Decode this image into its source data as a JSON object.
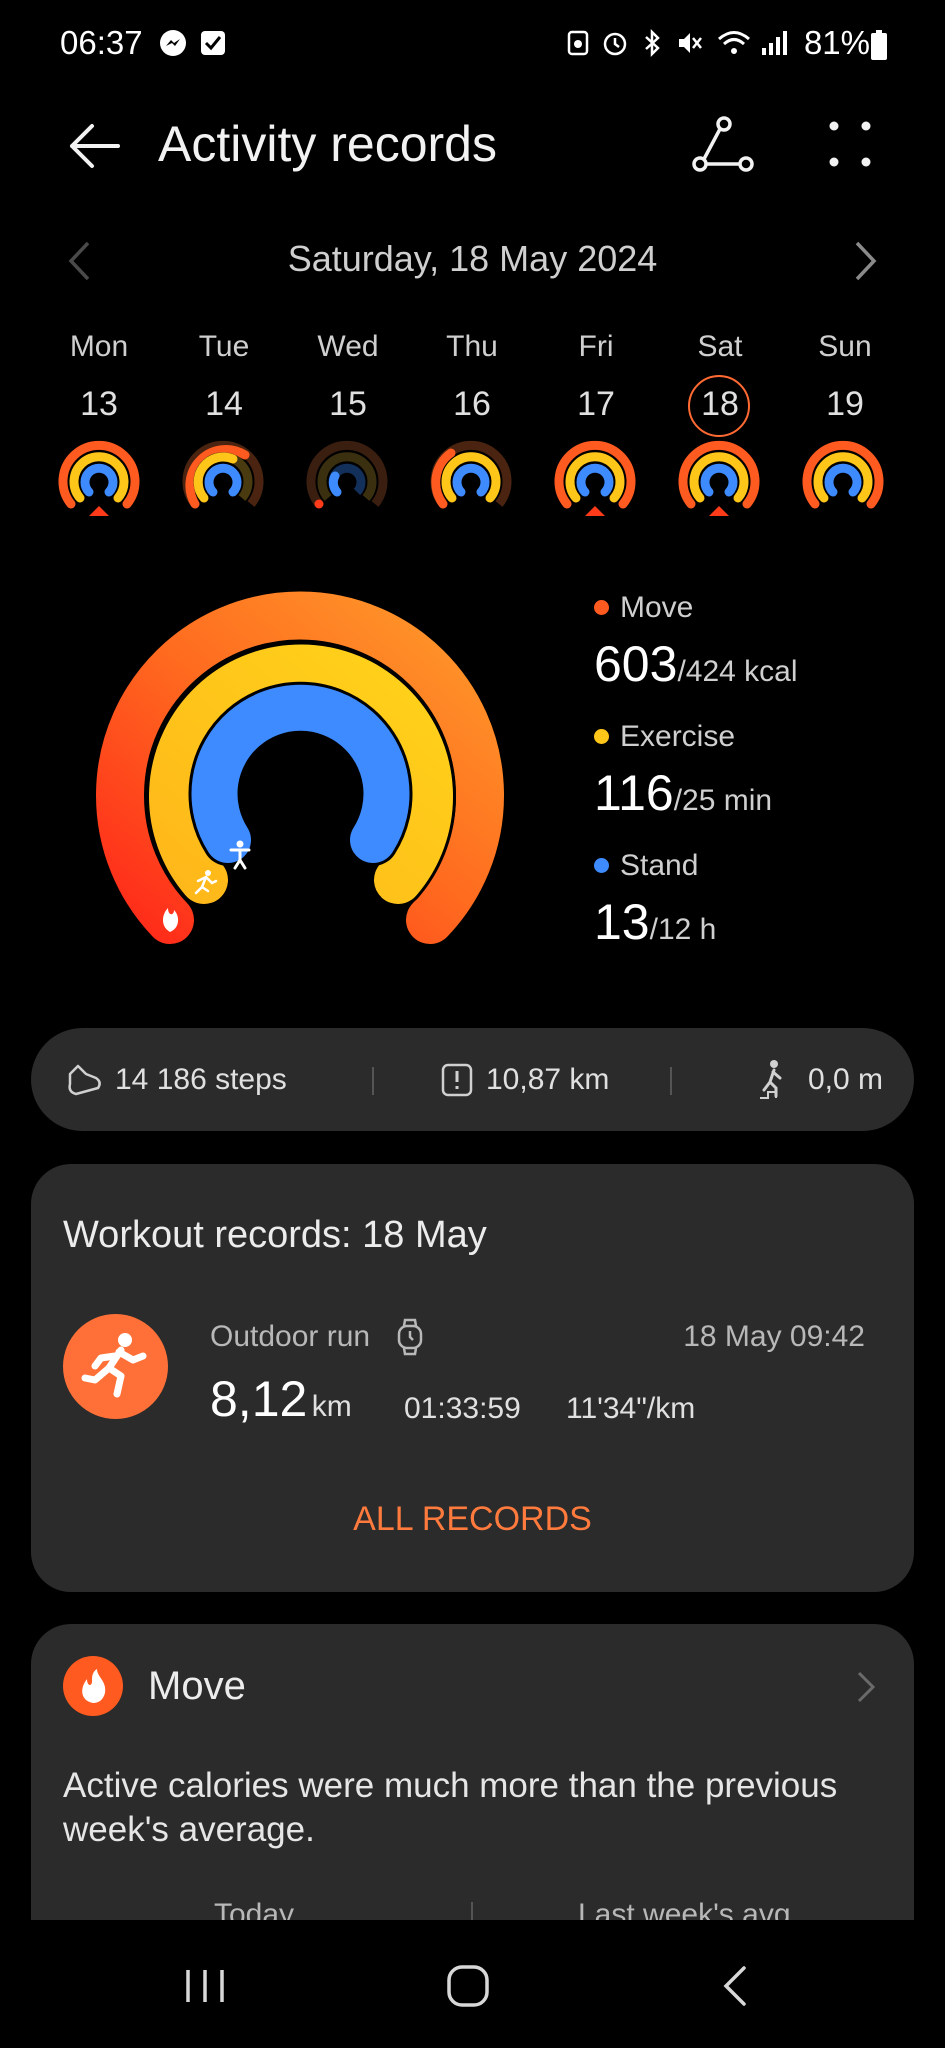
{
  "status": {
    "time": "06:37",
    "battery": "81%"
  },
  "header": {
    "title": "Activity records"
  },
  "date_nav": {
    "label": "Saturday, 18 May 2024"
  },
  "week": [
    {
      "name": "Mon",
      "num": "13"
    },
    {
      "name": "Tue",
      "num": "14"
    },
    {
      "name": "Wed",
      "num": "15"
    },
    {
      "name": "Thu",
      "num": "16"
    },
    {
      "name": "Fri",
      "num": "17"
    },
    {
      "name": "Sat",
      "num": "18"
    },
    {
      "name": "Sun",
      "num": "19"
    }
  ],
  "rings": {
    "move": {
      "label": "Move",
      "value": "603",
      "goal": "/424 kcal",
      "color": "#ff5a1f"
    },
    "exercise": {
      "label": "Exercise",
      "value": "116",
      "goal": "/25 min",
      "color": "#ffc61a"
    },
    "stand": {
      "label": "Stand",
      "value": "13",
      "goal": "/12 h",
      "color": "#3d8bff"
    }
  },
  "summary": {
    "steps": "14 186 steps",
    "distance": "10,87 km",
    "elevation": "0,0 m"
  },
  "workouts": {
    "title": "Workout records: 18 May",
    "type": "Outdoor run",
    "datetime": "18 May 09:42",
    "distance_value": "8,12",
    "distance_unit": "km",
    "duration": "01:33:59",
    "pace": "11'34\"/km",
    "all_records": "ALL RECORDS"
  },
  "move_card": {
    "title": "Move",
    "text": "Active calories were much more than the previous week's average.",
    "col1": "Today",
    "col2": "Last week's avg"
  }
}
